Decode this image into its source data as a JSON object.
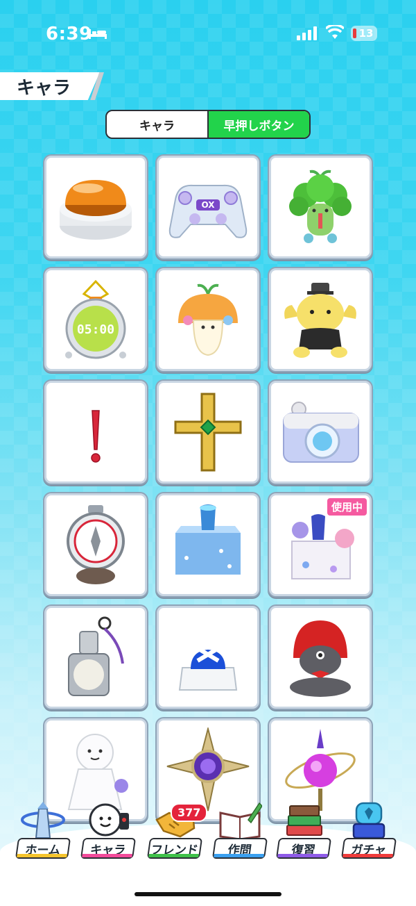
{
  "status_bar": {
    "time": "6:39",
    "battery": "13"
  },
  "header": {
    "title": "キャラ"
  },
  "segment": {
    "tabs": [
      {
        "label": "キャラ",
        "active": false
      },
      {
        "label": "早押しボタン",
        "active": true
      }
    ]
  },
  "items": [
    {
      "name": "orange-buzzer-button"
    },
    {
      "name": "game-controller"
    },
    {
      "name": "broccoli-sprout-character"
    },
    {
      "name": "stopwatch-timer",
      "display": "05:00"
    },
    {
      "name": "mushroom-sprout-character"
    },
    {
      "name": "yellow-dog-plush"
    },
    {
      "name": "red-exclamation"
    },
    {
      "name": "golden-cross"
    },
    {
      "name": "toy-camera"
    },
    {
      "name": "silver-pocket-watch"
    },
    {
      "name": "water-cube-buzzer"
    },
    {
      "name": "hydrangea-cube-buzzer",
      "badge": "使用中"
    },
    {
      "name": "keychain-buzzer"
    },
    {
      "name": "blue-ribbon-buzzer"
    },
    {
      "name": "red-hood-wolf"
    },
    {
      "name": "teru-teru-bozu"
    },
    {
      "name": "purple-compass-emblem"
    },
    {
      "name": "orb-staff"
    }
  ],
  "nav": {
    "items": [
      {
        "label": "ホーム",
        "stripe": "#f5c42c"
      },
      {
        "label": "キャラ",
        "stripe": "#f24a9a"
      },
      {
        "label": "フレンド",
        "stripe": "#3fc14a",
        "badge": "377"
      },
      {
        "label": "作問",
        "stripe": "#3aa0f0"
      },
      {
        "label": "復習",
        "stripe": "#8f5be8"
      },
      {
        "label": "ガチャ",
        "stripe": "#ef3b3b"
      }
    ]
  },
  "colors": {
    "accent_green": "#22d34b",
    "badge_pink": "#f55aa0",
    "badge_red": "#e4233b"
  }
}
